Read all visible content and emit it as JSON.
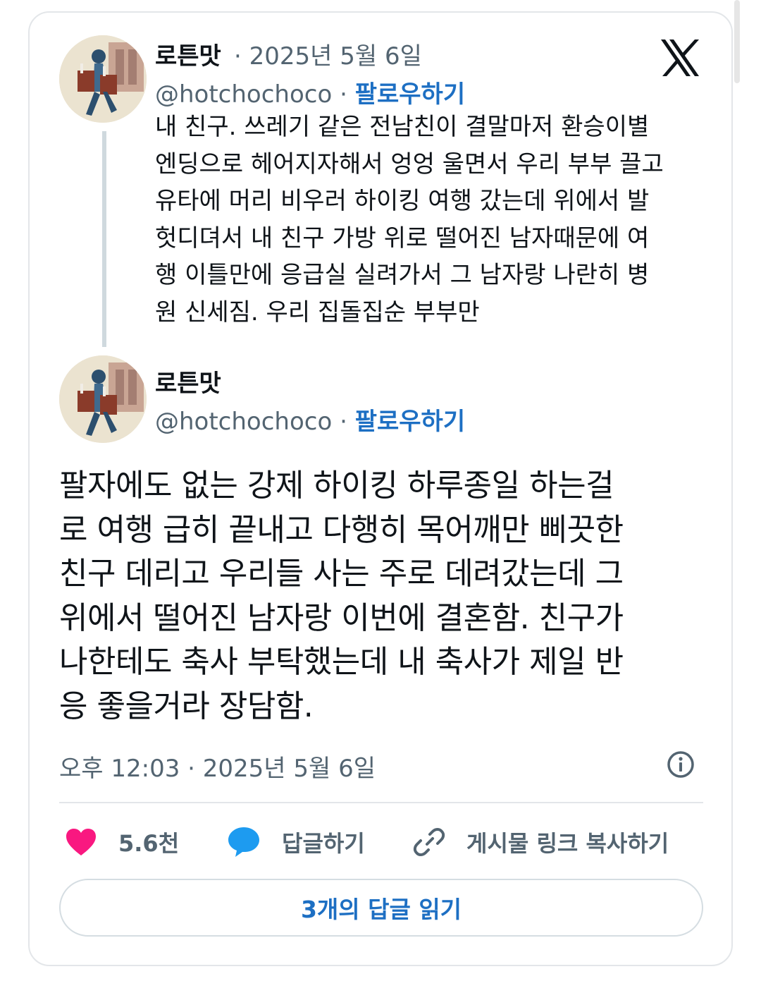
{
  "first_tweet": {
    "display_name": "로튼맛",
    "date": "2025년 5월 6일",
    "handle": "@hotchochoco",
    "follow_label": "팔로우하기",
    "text_lines": [
      "내 친구. 쓰레기 같은 전남친이 결말마저 환승이별",
      "엔딩으로 헤어지자해서 엉엉 울면서 우리 부부 끌고",
      "유타에 머리 비우러 하이킹 여행 갔는데 위에서 발",
      "헛디뎌서 내 친구 가방 위로 떨어진 남자때문에 여",
      "행 이틀만에 응급실 실려가서 그 남자랑 나란히 병",
      "원 신세짐. 우리 집돌집순 부부만"
    ]
  },
  "main_tweet": {
    "display_name": "로튼맛",
    "handle": "@hotchochoco",
    "follow_label": "팔로우하기",
    "text_lines": [
      "팔자에도 없는 강제 하이킹 하루종일 하는걸",
      "로 여행 급히 끝내고 다행히 목어깨만 삐끗한",
      "친구 데리고 우리들 사는 주로 데려갔는데 그",
      "위에서 떨어진 남자랑 이번에 결혼함. 친구가",
      "나한테도 축사 부탁했는데 내 축사가 제일 반",
      "응 좋을거라 장담함."
    ],
    "timestamp": "오후 12:03 · 2025년 5월 6일"
  },
  "actions": {
    "like_count": "5.6천",
    "reply_label": "답글하기",
    "copy_link_label": "게시물 링크 복사하기",
    "read_replies_label": "3개의 답글 읽기"
  },
  "icons": {
    "brand": "x-logo-icon",
    "like": "heart-icon",
    "reply": "speech-bubble-icon",
    "copy_link": "link-icon",
    "info": "info-icon"
  },
  "colors": {
    "heart": "#f91880",
    "reply_bubble": "#1d9bf0",
    "follow_link": "#1d6fc3",
    "muted_text": "#536471"
  }
}
